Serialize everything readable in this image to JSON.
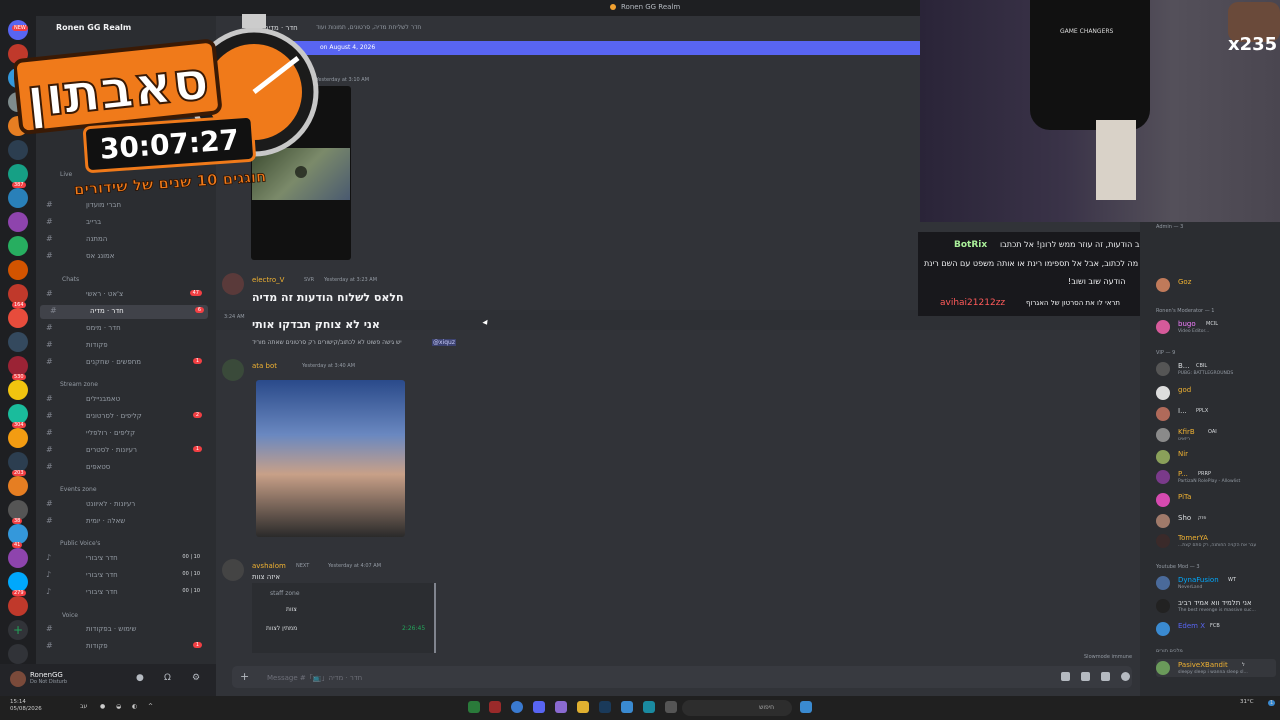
{
  "window": {
    "title": "Ronen GG Realm"
  },
  "server": {
    "name": "Ronen GG Realm"
  },
  "server_rail": {
    "badges": [
      "NEW",
      "387",
      "164",
      "530",
      "304",
      "203",
      "38",
      "41",
      "279",
      "6"
    ]
  },
  "categories": {
    "chats": "Chats",
    "stream_zone": "Stream zone",
    "events_zone": "Events zone",
    "public_voice": "Public Voice's",
    "voice": "Voice"
  },
  "channels": {
    "top": [
      {
        "label": "חברי מועדון"
      },
      {
        "label": "ברייב"
      },
      {
        "label": "המתנה"
      },
      {
        "label": "אמונג אס"
      }
    ],
    "chats": [
      {
        "label": "צ'אט · ראשי",
        "badge": "47"
      },
      {
        "label": "חדר · מדיה",
        "badge": "6"
      },
      {
        "label": "חדר · מימס"
      },
      {
        "label": "פקודות"
      },
      {
        "label": "מחפשים · שחקנים",
        "badge": "1"
      }
    ],
    "stream": [
      {
        "label": "טאמבניילים"
      },
      {
        "label": "קליפים · לסרטונים",
        "badge": "2"
      },
      {
        "label": "קליפים · רולפליי"
      },
      {
        "label": "רעיונות · לסטרים",
        "badge": "1"
      },
      {
        "label": "סטאפים"
      }
    ],
    "events": [
      {
        "label": "רעיונות · לאיוונט"
      },
      {
        "label": "שאלה · יומית"
      }
    ],
    "public_voice": [
      {
        "label": "חדר ציבורי",
        "count": "00 | 10"
      },
      {
        "label": "חדר ציבורי",
        "count": "00 | 10"
      },
      {
        "label": "חדר ציבורי",
        "count": "00 | 10"
      }
    ],
    "voice": [
      {
        "label": "שימוש · בפקודות"
      },
      {
        "label": "פקודות",
        "badge": "1"
      }
    ],
    "tickets_label": "ticke",
    "live_label": "Live"
  },
  "user_panel": {
    "name": "RonenGG",
    "status": "Do Not Disturb"
  },
  "chat": {
    "channel_title": "חדר · מדיה",
    "topic": "חדר לשליחת מדיה, סרטונים, תמונות ועוד",
    "new_messages_bar": "on August 4, 2026",
    "first_time": "Yesterday at 3:10 AM",
    "messages": [
      {
        "author": "electro_V",
        "tag": "SVR",
        "time": "Yesterday at 3:23 AM",
        "lines": [
          "חלאס לשלוח הודעות זה מדיה"
        ]
      },
      {
        "side_time": "3:24 AM",
        "lines": [
          "אני לא צוחק תבדקו אותי"
        ]
      },
      {
        "reply": "יש גישה פשוט לא לכתוב/קישורים רק סרטונים שאתה מוריד",
        "mention": "@xiquz"
      },
      {
        "author": "ata bot",
        "time": "Yesterday at 3:40 AM"
      },
      {
        "author": "avshalom",
        "tag": "NEXT",
        "time": "Yesterday at 4:07 AM",
        "lines": [
          "איזה צוות"
        ]
      }
    ],
    "embed": {
      "category": "staff zone",
      "rows": [
        {
          "label": "צוות"
        },
        {
          "label": "ממתין לצוות",
          "time": "2:26:45"
        }
      ]
    },
    "composer_placeholder": "Message #「📺」חדר · מדיה",
    "slowmode": "Slowmode immune"
  },
  "overlay_chat": [
    {
      "text": "ר את הצ'אט פעיל לכתוב הודעות, זה עוזר ממש לרונן! אל תכתבו",
      "user": "BotRix"
    },
    {
      "text": "אין לכם מה לכתוב, אבל אל תספימו רינת או אותה משפט עם השם רינת"
    },
    {
      "text": "!הודעה שוב ושוב"
    },
    {
      "text": "תראי לו את הסרטון של האגרוף",
      "user": "avihai21212zz"
    }
  ],
  "members": {
    "roles": [
      "Admin — 3",
      "Ronen's Moderator — 1",
      "VIP — 9",
      "Youtube Mod — 3",
      "מלכים תורים"
    ],
    "list": [
      {
        "name": "Goz",
        "color": "#f0b232"
      },
      {
        "name": "bugo",
        "tag": "MCIL",
        "sub": "Video Editor...",
        "color": "#f47fff"
      },
      {
        "name": "B...",
        "tag": "CBIL",
        "sub": "PUBG: BATTLEGROUNDS",
        "color": "#f2f3f5"
      },
      {
        "name": "god",
        "color": "#f0b232"
      },
      {
        "name": "I...",
        "tag": "PPLX",
        "color": "#f2f3f5"
      },
      {
        "name": "KfirB",
        "tag": "OAI",
        "sub": "ריזאיט",
        "color": "#f0b232"
      },
      {
        "name": "Nir",
        "color": "#f0b232"
      },
      {
        "name": "P...",
        "tag": "PRRP",
        "sub": "PartizaN RolePlay - Allowlist",
        "color": "#f0b232"
      },
      {
        "name": "PiTa",
        "color": "#f0b232"
      },
      {
        "name": "Sho",
        "tag": "פזק",
        "color": "#f2f3f5"
      },
      {
        "name": "TomerYA",
        "sub": "...עבר את הקניה החותנה, רק סתם קצת",
        "color": "#f0b232"
      },
      {
        "name": "DynaFusion",
        "tag": "WT",
        "sub": "NeverLand",
        "color": "#00a8fc"
      },
      {
        "name": "אני תלמיד ווא אמיד רביב",
        "sub": "The best revenge is massive suc...",
        "color": "#f2f3f5"
      },
      {
        "name": "Edem X",
        "tag": "FCB",
        "color": "#5865f2"
      },
      {
        "name": "PasiveXBandit",
        "tag": "ל",
        "sub": "sleepy sleep i wanna sleep sl...",
        "color": "#f0b232"
      }
    ]
  },
  "stream_overlay": {
    "event_name": "סאבתון",
    "timer": "30:07:27",
    "tagline": "חוגגים 10 שנים של שידורים",
    "sub_multiplier": "x235",
    "shirt_text": "GAME CHANGERS"
  },
  "taskbar": {
    "time": "15:14",
    "date": "05/08/2026",
    "search_placeholder": "חיפוש",
    "lang": "עב",
    "weather": "31°C",
    "notif_count": "1"
  },
  "colors": {
    "accent": "#5865f2",
    "danger": "#f23f43",
    "online": "#23a55a"
  }
}
